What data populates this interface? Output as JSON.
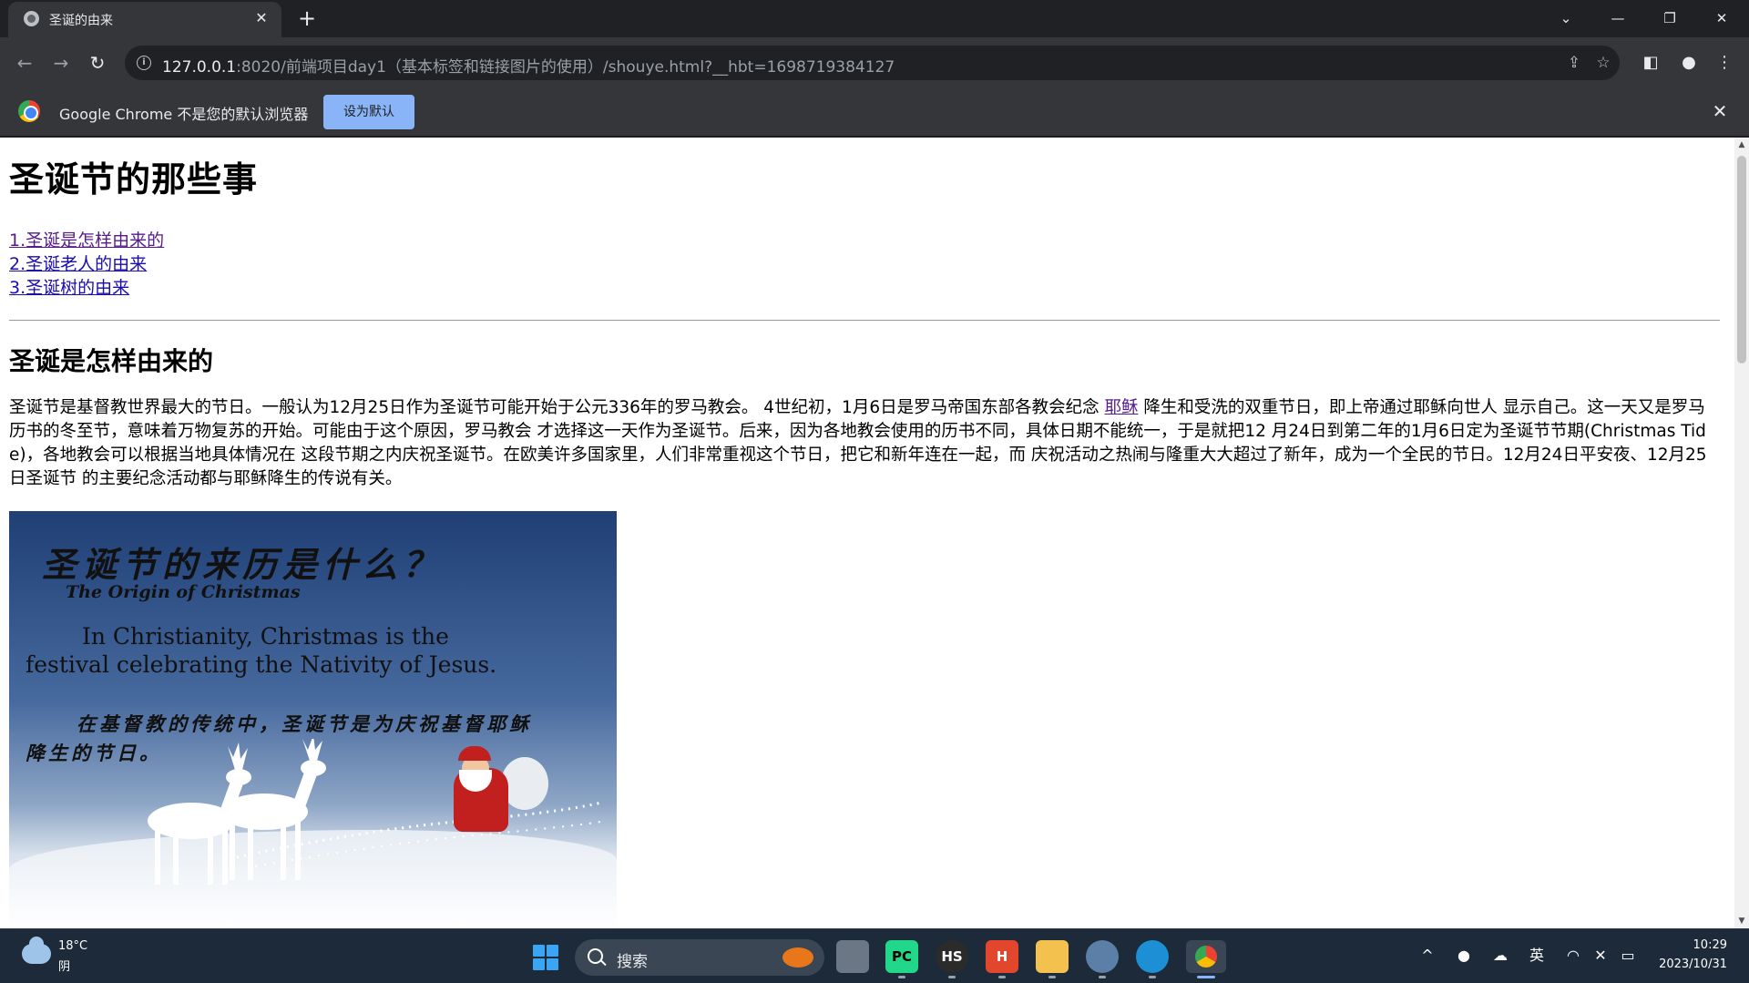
{
  "browser": {
    "tab_title": "圣诞的由来",
    "url_host": "127.0.0.1",
    "url_rest": ":8020/前端项目day1（基本标签和链接图片的使用）/shouye.html?__hbt=1698719384127",
    "infobar_message": "Google Chrome 不是您的默认浏览器",
    "set_default_label": "设为默认"
  },
  "page": {
    "title": "圣诞节的那些事",
    "toc": [
      "1.圣诞是怎样由来的",
      "2.圣诞老人的由来",
      "3.圣诞树的由来"
    ],
    "section_heading": "圣诞是怎样由来的",
    "para_before_link": "圣诞节是基督教世界最大的节日。一般认为12月25日作为圣诞节可能开始于公元336年的罗马教会。 4世纪初，1月6日是罗马帝国东部各教会纪念 ",
    "para_link": "耶稣",
    "para_after_link": " 降生和受洗的双重节日，即上帝通过耶稣向世人 显示自己。这一天又是罗马历书的冬至节，意味着万物复苏的开始。可能由于这个原因，罗马教会 才选择这一天作为圣诞节。后来，因为各地教会使用的历书不同，具体日期不能统一，于是就把12 月24日到第二年的1月6日定为圣诞节节期(Christmas Tide)，各地教会可以根据当地具体情况在 这段节期之内庆祝圣诞节。在欧美许多国家里，人们非常重视这个节日，把它和新年连在一起，而 庆祝活动之热闹与隆重大大超过了新年，成为一个全民的节日。12月24日平安夜、12月25日圣诞节 的主要纪念活动都与耶稣降生的传说有关。",
    "image_text": {
      "title_cn": "圣诞节的来历是什么？",
      "title_en": "The Origin of Christmas",
      "body_en": "In Christianity, Christmas is the festival celebrating the Nativity of Jesus.",
      "body_cn": "在基督教的传统中，圣诞节是为庆祝基督耶稣降生的节日。"
    }
  },
  "taskbar": {
    "temperature": "18°C",
    "condition": "阴",
    "search_label": "搜索",
    "ime": "英",
    "time": "10:29",
    "date": "2023/10/31",
    "apps": [
      "PC",
      "HS",
      "H"
    ]
  }
}
